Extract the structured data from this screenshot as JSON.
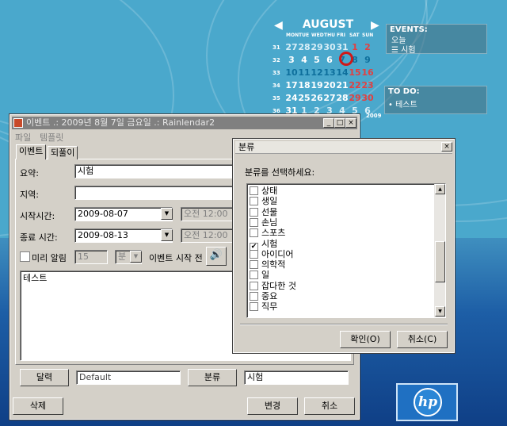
{
  "calendar": {
    "month": "AUGUST",
    "prev_arrow": "◀",
    "next_arrow": "▶",
    "weekdays": [
      "MON",
      "TUE",
      "WED",
      "THU",
      "FRI",
      "SAT",
      "SUN"
    ],
    "weeks": [
      "31",
      "32",
      "33",
      "34",
      "35",
      "36"
    ],
    "rows": [
      [
        "27",
        "28",
        "29",
        "30",
        "31",
        "1",
        "2"
      ],
      [
        "3",
        "4",
        "5",
        "6",
        "7",
        "8",
        "9"
      ],
      [
        "10",
        "11",
        "12",
        "13",
        "14",
        "15",
        "16"
      ],
      [
        "17",
        "18",
        "19",
        "20",
        "21",
        "22",
        "23"
      ],
      [
        "24",
        "25",
        "26",
        "27",
        "28",
        "29",
        "30"
      ],
      [
        "31",
        "1",
        "2",
        "3",
        "4",
        "5",
        "6"
      ]
    ],
    "year": "2009"
  },
  "events_panel": {
    "header": "EVENTS:",
    "day": "오늘",
    "item": "시험"
  },
  "todo_panel": {
    "header": "TO DO:",
    "item": "• 테스트"
  },
  "event_window": {
    "title": "이벤트 .: 2009년 8월 7일 금요일 .: Rainlendar2",
    "menu": [
      "파일",
      "템플릿"
    ],
    "tabs": [
      "이벤트",
      "되풀이"
    ],
    "summary_label": "요약:",
    "summary_value": "시험",
    "location_label": "지역:",
    "location_value": "",
    "start_label": "시작시간:",
    "start_date": "2009-08-07",
    "start_time": "오전 12:00",
    "end_label": "종료 시간:",
    "end_date": "2009-08-13",
    "end_time": "오전 12:00",
    "alarm_label": "미리 알림",
    "alarm_value": "15",
    "alarm_unit": "분",
    "alarm_before": "이벤트 시작 전",
    "description": "테스트",
    "calendar_button": "달력",
    "calendar_value": "Default",
    "category_button": "분류",
    "category_value": "시험",
    "delete_button": "삭제",
    "change_button": "변경",
    "cancel_button": "취소"
  },
  "category_dialog": {
    "title": "분류",
    "prompt": "분류를 선택하세요:",
    "items": [
      {
        "label": "상태",
        "checked": false
      },
      {
        "label": "생일",
        "checked": false
      },
      {
        "label": "선물",
        "checked": false
      },
      {
        "label": "손님",
        "checked": false
      },
      {
        "label": "스포츠",
        "checked": false
      },
      {
        "label": "시험",
        "checked": true
      },
      {
        "label": "아이디어",
        "checked": false
      },
      {
        "label": "의학적",
        "checked": false
      },
      {
        "label": "일",
        "checked": false
      },
      {
        "label": "잡다한 것",
        "checked": false
      },
      {
        "label": "중요",
        "checked": false
      },
      {
        "label": "직무",
        "checked": false
      }
    ],
    "ok_button": "확인(O)",
    "cancel_button": "취소(C)"
  },
  "hp_logo": "hp"
}
